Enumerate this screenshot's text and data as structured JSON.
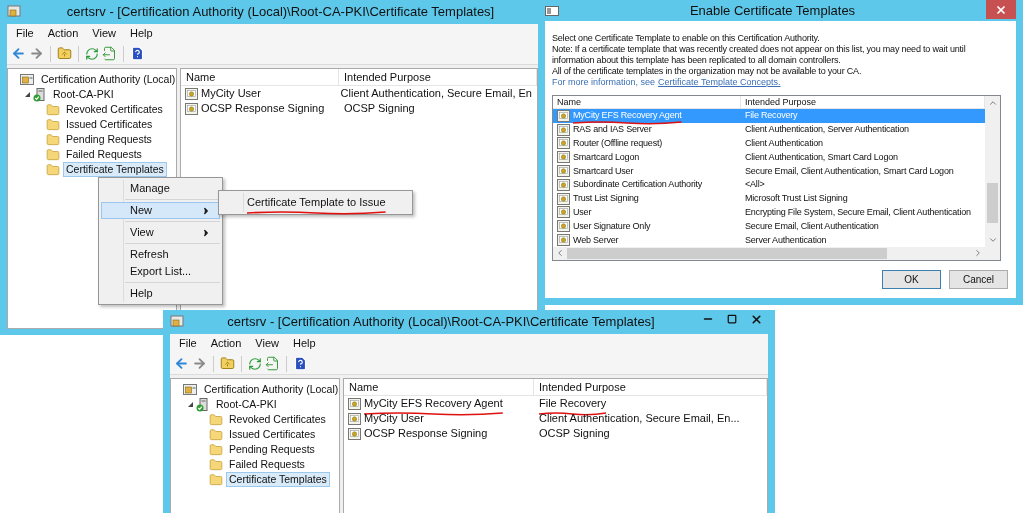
{
  "back_window": {
    "title": "certsrv - [Certification Authority (Local)\\Root-CA-PKI\\Certificate Templates]",
    "window_buttons": false,
    "menu": [
      "File",
      "Action",
      "View",
      "Help"
    ],
    "tree": [
      {
        "label": "Certification Authority (Local)",
        "kind": "authority",
        "selected": false,
        "children": [
          {
            "label": "Root-CA-PKI",
            "kind": "ca",
            "expanded": true,
            "selected": false,
            "children": [
              {
                "label": "Revoked Certificates",
                "kind": "folder",
                "selected": false
              },
              {
                "label": "Issued Certificates",
                "kind": "folder",
                "selected": false
              },
              {
                "label": "Pending Requests",
                "kind": "folder",
                "selected": false
              },
              {
                "label": "Failed Requests",
                "kind": "folder",
                "selected": false
              },
              {
                "label": "Certificate Templates",
                "kind": "folder",
                "selected": true
              }
            ]
          }
        ]
      }
    ],
    "columns": [
      "Name",
      "Intended Purpose"
    ],
    "rows": [
      {
        "name": "MyCity User",
        "purpose": "Client Authentication, Secure Email, En",
        "selected": false,
        "name_underlined": false,
        "purpose_underlined": false
      },
      {
        "name": "OCSP Response Signing",
        "purpose": "OCSP Signing",
        "selected": false,
        "name_underlined": false,
        "purpose_underlined": false
      }
    ]
  },
  "context_menu": {
    "items": [
      {
        "kind": "item",
        "label": "Manage",
        "highlighted": false
      },
      {
        "kind": "separator"
      },
      {
        "kind": "submenu",
        "label": "New",
        "highlighted": true
      },
      {
        "kind": "separator"
      },
      {
        "kind": "submenu",
        "label": "View",
        "highlighted": false
      },
      {
        "kind": "separator"
      },
      {
        "kind": "item",
        "label": "Refresh",
        "highlighted": false
      },
      {
        "kind": "item",
        "label": "Export List...",
        "highlighted": false
      },
      {
        "kind": "separator"
      },
      {
        "kind": "item",
        "label": "Help",
        "highlighted": false
      }
    ],
    "submenu": [
      {
        "label": "Certificate Template to Issue",
        "underlined": true
      }
    ]
  },
  "dialog": {
    "title": "Enable Certificate Templates",
    "intro": [
      "Select one Certificate Template to enable on this Certification Authority.",
      "Note: If a certificate template that was recently created does not appear on this list, you may need to wait until information about this template has been replicated to all domain controllers.",
      "All of the certificate templates in the organization may not be available to your CA."
    ],
    "more_info": "For more information, see",
    "link": "Certificate Template Concepts.",
    "columns": [
      "Name",
      "Intended Purpose"
    ],
    "rows": [
      {
        "name": "MyCity EFS Recovery Agent",
        "purpose": "File Recovery",
        "selected": true,
        "name_underlined": true
      },
      {
        "name": "RAS and IAS Server",
        "purpose": "Client Authentication, Server Authentication",
        "selected": false,
        "name_underlined": false
      },
      {
        "name": "Router (Offline request)",
        "purpose": "Client Authentication",
        "selected": false,
        "name_underlined": false
      },
      {
        "name": "Smartcard Logon",
        "purpose": "Client Authentication, Smart Card Logon",
        "selected": false,
        "name_underlined": false
      },
      {
        "name": "Smartcard User",
        "purpose": "Secure Email, Client Authentication, Smart Card Logon",
        "selected": false,
        "name_underlined": false
      },
      {
        "name": "Subordinate Certification Authority",
        "purpose": "<All>",
        "selected": false,
        "name_underlined": false
      },
      {
        "name": "Trust List Signing",
        "purpose": "Microsoft Trust List Signing",
        "selected": false,
        "name_underlined": false
      },
      {
        "name": "User",
        "purpose": "Encrypting File System, Secure Email, Client Authentication",
        "selected": false,
        "name_underlined": false
      },
      {
        "name": "User Signature Only",
        "purpose": "Secure Email, Client Authentication",
        "selected": false,
        "name_underlined": false
      },
      {
        "name": "Web Server",
        "purpose": "Server Authentication",
        "selected": false,
        "name_underlined": false
      }
    ],
    "buttons": [
      {
        "label": "OK",
        "default": true
      },
      {
        "label": "Cancel",
        "default": false
      }
    ]
  },
  "front_window": {
    "title": "certsrv - [Certification Authority (Local)\\Root-CA-PKI\\Certificate Templates]",
    "window_buttons": true,
    "menu": [
      "File",
      "Action",
      "View",
      "Help"
    ],
    "tree": [
      {
        "label": "Certification Authority (Local)",
        "kind": "authority",
        "selected": false,
        "children": [
          {
            "label": "Root-CA-PKI",
            "kind": "ca",
            "expanded": true,
            "selected": false,
            "children": [
              {
                "label": "Revoked Certificates",
                "kind": "folder",
                "selected": false
              },
              {
                "label": "Issued Certificates",
                "kind": "folder",
                "selected": false
              },
              {
                "label": "Pending Requests",
                "kind": "folder",
                "selected": false
              },
              {
                "label": "Failed Requests",
                "kind": "folder",
                "selected": false
              },
              {
                "label": "Certificate Templates",
                "kind": "folder",
                "selected": true
              }
            ]
          }
        ]
      }
    ],
    "columns": [
      "Name",
      "Intended Purpose"
    ],
    "rows": [
      {
        "name": "MyCity EFS Recovery Agent",
        "purpose": "File Recovery",
        "selected": false,
        "name_underlined": true,
        "purpose_underlined": true
      },
      {
        "name": "MyCity User",
        "purpose": "Client Authentication, Secure Email, En...",
        "selected": false,
        "name_underlined": false,
        "purpose_underlined": false
      },
      {
        "name": "OCSP Response Signing",
        "purpose": "OCSP Signing",
        "selected": false,
        "name_underlined": false,
        "purpose_underlined": false
      }
    ]
  }
}
